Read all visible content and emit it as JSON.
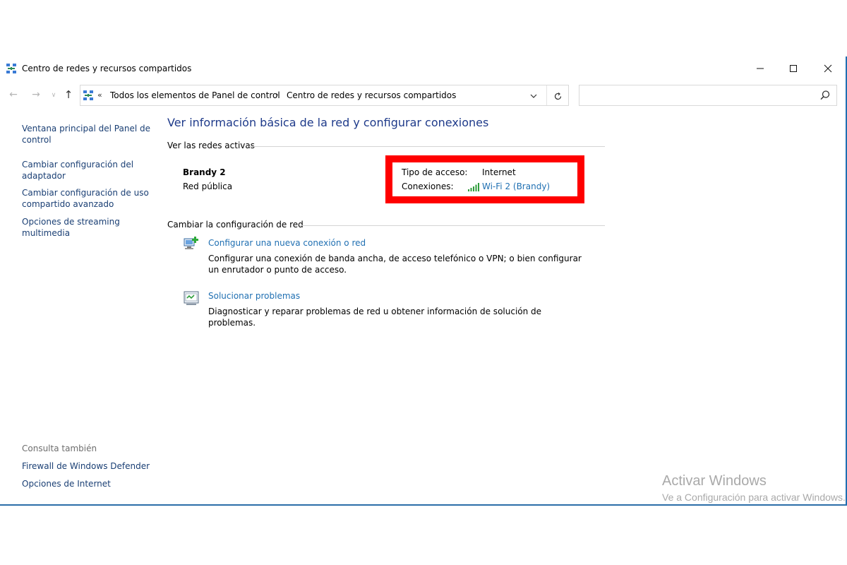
{
  "window": {
    "title": "Centro de redes y recursos compartidos"
  },
  "navbar": {
    "breadcrumb": [
      "Todos los elementos de Panel de control",
      "Centro de redes y recursos compartidos"
    ],
    "search_placeholder": ""
  },
  "sidebar": {
    "links": [
      "Ventana principal del Panel de control",
      "Cambiar configuración del adaptador",
      "Cambiar configuración de uso compartido avanzado",
      "Opciones de streaming multimedia"
    ],
    "see_also_label": "Consulta también",
    "see_also": [
      "Firewall de Windows Defender",
      "Opciones de Internet"
    ]
  },
  "main": {
    "title": "Ver información básica de la red y configurar conexiones",
    "active_networks_label": "Ver las redes activas",
    "network": {
      "name": "Brandy 2",
      "type": "Red pública",
      "access_label": "Tipo de acceso:",
      "access_value": "Internet",
      "connections_label": "Conexiones:",
      "connection_link": "Wi-Fi 2 (Brandy)"
    },
    "change_settings_label": "Cambiar la configuración de red",
    "tasks": [
      {
        "title": "Configurar una nueva conexión o red",
        "desc": "Configurar una conexión de banda ancha, de acceso telefónico o VPN; o bien configurar un enrutador o punto de acceso.",
        "icon": "new-connection-icon"
      },
      {
        "title": "Solucionar problemas",
        "desc": "Diagnosticar y reparar problemas de red u obtener información de solución de problemas.",
        "icon": "troubleshoot-icon"
      }
    ]
  },
  "watermark": {
    "line1": "Activar Windows",
    "line2": "Ve a Configuración para activar Windows."
  },
  "colors": {
    "link": "#1f6fb2",
    "title": "#1e3a8a",
    "highlight": "#ff0000"
  }
}
